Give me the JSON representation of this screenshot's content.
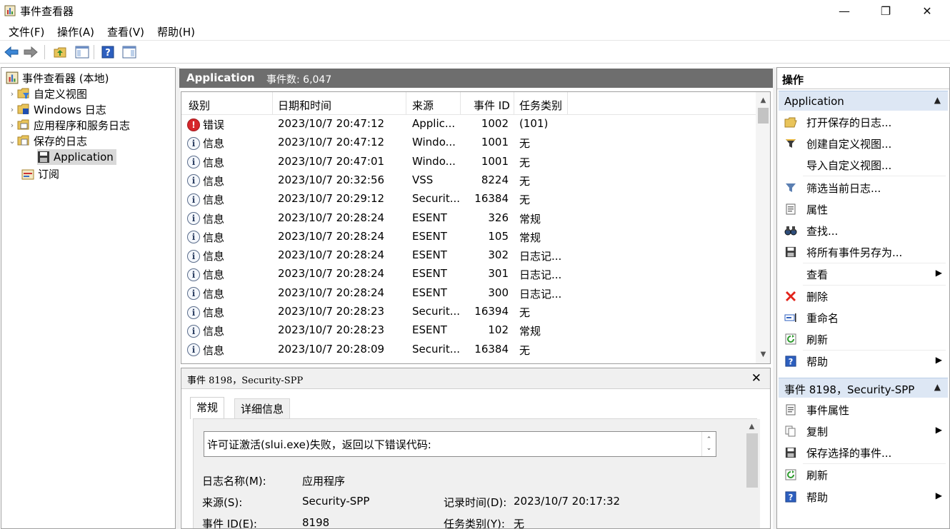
{
  "window": {
    "title": "事件查看器",
    "minimize": "—",
    "maximize": "❐",
    "close": "✕"
  },
  "menu": [
    "文件(F)",
    "操作(A)",
    "查看(V)",
    "帮助(H)"
  ],
  "tree": {
    "root": "事件查看器 (本地)",
    "items": [
      "自定义视图",
      "Windows 日志",
      "应用程序和服务日志",
      "保存的日志"
    ],
    "child": "Application",
    "subscriptions": "订阅"
  },
  "header": {
    "log_name": "Application",
    "count": "事件数: 6,047"
  },
  "columns": [
    "级别",
    "日期和时间",
    "来源",
    "事件 ID",
    "任务类别"
  ],
  "rows": [
    {
      "level": "错误",
      "type": "error",
      "datetime": "2023/10/7 20:47:12",
      "source": "Applic...",
      "id": "1002",
      "task": "(101)"
    },
    {
      "level": "信息",
      "type": "info",
      "datetime": "2023/10/7 20:47:12",
      "source": "Windo...",
      "id": "1001",
      "task": "无"
    },
    {
      "level": "信息",
      "type": "info",
      "datetime": "2023/10/7 20:47:01",
      "source": "Windo...",
      "id": "1001",
      "task": "无"
    },
    {
      "level": "信息",
      "type": "info",
      "datetime": "2023/10/7 20:32:56",
      "source": "VSS",
      "id": "8224",
      "task": "无"
    },
    {
      "level": "信息",
      "type": "info",
      "datetime": "2023/10/7 20:29:12",
      "source": "Securit...",
      "id": "16384",
      "task": "无"
    },
    {
      "level": "信息",
      "type": "info",
      "datetime": "2023/10/7 20:28:24",
      "source": "ESENT",
      "id": "326",
      "task": "常规"
    },
    {
      "level": "信息",
      "type": "info",
      "datetime": "2023/10/7 20:28:24",
      "source": "ESENT",
      "id": "105",
      "task": "常规"
    },
    {
      "level": "信息",
      "type": "info",
      "datetime": "2023/10/7 20:28:24",
      "source": "ESENT",
      "id": "302",
      "task": "日志记..."
    },
    {
      "level": "信息",
      "type": "info",
      "datetime": "2023/10/7 20:28:24",
      "source": "ESENT",
      "id": "301",
      "task": "日志记..."
    },
    {
      "level": "信息",
      "type": "info",
      "datetime": "2023/10/7 20:28:24",
      "source": "ESENT",
      "id": "300",
      "task": "日志记..."
    },
    {
      "level": "信息",
      "type": "info",
      "datetime": "2023/10/7 20:28:23",
      "source": "Securit...",
      "id": "16394",
      "task": "无"
    },
    {
      "level": "信息",
      "type": "info",
      "datetime": "2023/10/7 20:28:23",
      "source": "ESENT",
      "id": "102",
      "task": "常规"
    },
    {
      "level": "信息",
      "type": "info",
      "datetime": "2023/10/7 20:28:09",
      "source": "Securit...",
      "id": "16384",
      "task": "无"
    }
  ],
  "detail": {
    "title": "事件 8198，Security-SPP",
    "close": "✕",
    "tabs": [
      "常规",
      "详细信息"
    ],
    "message": "许可证激活(slui.exe)失败，返回以下错误代码:",
    "fields": {
      "log_name_label": "日志名称(M):",
      "log_name_value": "应用程序",
      "source_label": "来源(S):",
      "source_value": "Security-SPP",
      "logged_label": "记录时间(D):",
      "logged_value": "2023/10/7 20:17:32",
      "event_id_label": "事件 ID(E):",
      "event_id_value": "8198",
      "task_label": "任务类别(Y):",
      "task_value": "无"
    }
  },
  "actions": {
    "title": "操作",
    "section1": "Application",
    "items1": [
      "打开保存的日志...",
      "创建自定义视图...",
      "导入自定义视图...",
      "筛选当前日志...",
      "属性",
      "查找...",
      "将所有事件另存为...",
      "查看",
      "删除",
      "重命名",
      "刷新",
      "帮助"
    ],
    "section2": "事件 8198，Security-SPP",
    "items2": [
      "事件属性",
      "复制",
      "保存选择的事件...",
      "刷新",
      "帮助"
    ]
  },
  "colors": {
    "header_bg": "#6e6e6e",
    "section_bg": "#dde7f4",
    "selected": "#d9d9d9",
    "error": "#d6262b"
  }
}
